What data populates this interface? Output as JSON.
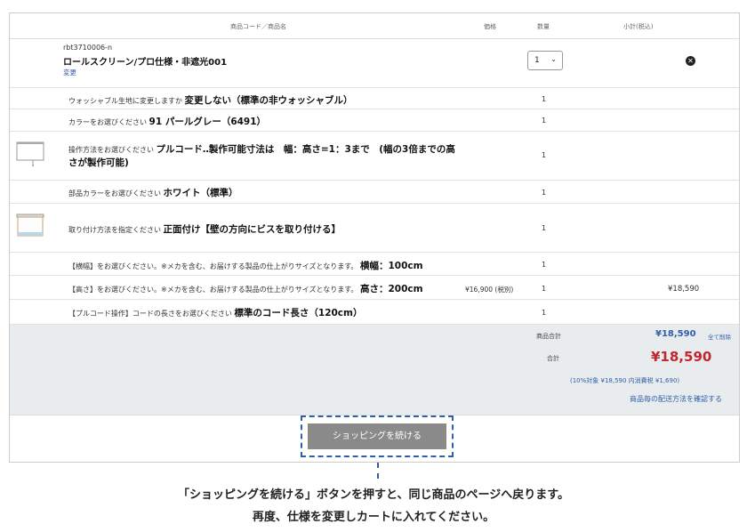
{
  "header": {
    "col_product": "商品コード／商品名",
    "col_price": "価格",
    "col_qty": "数量",
    "col_subtotal": "小計(税込)"
  },
  "product": {
    "code": "rbt3710006-n",
    "name": "ロールスクリーン/プロ仕様・非遮光001",
    "change_link": "変更",
    "qty_selected": "1",
    "delete_icon": "delete-icon"
  },
  "options": [
    {
      "label": "ウォッシャブル生地に変更しますか",
      "value": "変更しない（標準の非ウォッシャブル）",
      "qty": "1"
    },
    {
      "label": "カラーをお選びください",
      "value": "91 パールグレー（6491）",
      "qty": "1"
    },
    {
      "label": "操作方法をお選びください",
      "value": "プルコード‥製作可能寸法は　幅：高さ=1：3まで　(幅の3倍までの高",
      "value2": "さが製作可能)",
      "qty": "1"
    },
    {
      "label": "部品カラーをお選びください",
      "value": "ホワイト（標準）",
      "qty": "1"
    },
    {
      "label": "取り付け方法を指定ください",
      "value": "正面付け【壁の方向にビスを取り付ける】",
      "qty": "1"
    },
    {
      "label": "【横幅】をお選びください。※メカを含む、お届けする製品の仕上がりサイズとなります。",
      "value": "横幅：100cm",
      "qty": "1"
    },
    {
      "label": "【高さ】をお選びください。※メカを含む、お届けする製品の仕上がりサイズとなります。",
      "value": "高さ：200cm",
      "qty": "1",
      "price": "¥16,900 (税別)",
      "subtotal": "¥18,590"
    },
    {
      "label": "【プルコード操作】コードの長さをお選びください",
      "value": "標準のコード長さ（120cm）",
      "qty": "1"
    }
  ],
  "summary": {
    "item_total_label": "商品合計",
    "item_total": "¥18,590",
    "delete_all": "全て削除",
    "total_label": "合計",
    "total": "¥18,590",
    "tax_note": "(10%対象 ¥18,590  内消費税 ¥1,690)",
    "shipping_link": "商品毎の配送方法を確認する"
  },
  "continue_button": "ショッピングを続ける",
  "caption": {
    "line1": "「ショッピングを続ける」ボタンを押すと、同じ商品のページへ戻ります。",
    "line2": "再度、仕様を変更しカートに入れてください。"
  },
  "colors": {
    "accent_blue": "#2f5fa7",
    "total_red": "#c0282d",
    "summary_bg": "#e8ecef"
  }
}
